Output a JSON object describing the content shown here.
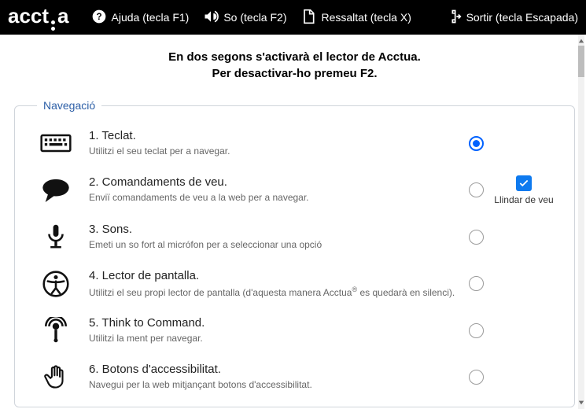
{
  "logo": "acctua",
  "topbar": {
    "help": {
      "label": "Ajuda (tecla F1)"
    },
    "sound": {
      "label": "So (tecla F2)"
    },
    "highlight": {
      "label": "Ressaltat (tecla X)"
    },
    "exit": {
      "label": "Sortir (tecla Escapada)"
    }
  },
  "intro": {
    "line1": "En dos segons s'activarà el lector de Acctua.",
    "line2": "Per desactivar-ho premeu F2."
  },
  "fieldset": {
    "legend": "Navegació"
  },
  "options": [
    {
      "title": "1. Teclat.",
      "desc": "Utilitzi el seu teclat per a navegar.",
      "selected": true
    },
    {
      "title": "2. Comandaments de veu.",
      "desc": "Enviï comandaments de veu a la web per a navegar.",
      "selected": false,
      "threshold_label": "Llindar de veu",
      "threshold_checked": true
    },
    {
      "title": "3. Sons.",
      "desc": "Emeti un so fort al micrófon per a seleccionar una opció",
      "selected": false
    },
    {
      "title": "4. Lector de pantalla.",
      "desc_pre": "Utilitzi el seu propi lector de pantalla (d'aquesta manera Acctua",
      "desc_sup": "®",
      "desc_post": " es quedarà en silenci).",
      "selected": false
    },
    {
      "title": "5. Think to Command.",
      "desc": "Utilitzi la ment per navegar.",
      "selected": false
    },
    {
      "title": "6. Botons d'accessibilitat.",
      "desc": "Navegui per la web mitjançant botons d'accessibilitat.",
      "selected": false
    }
  ]
}
